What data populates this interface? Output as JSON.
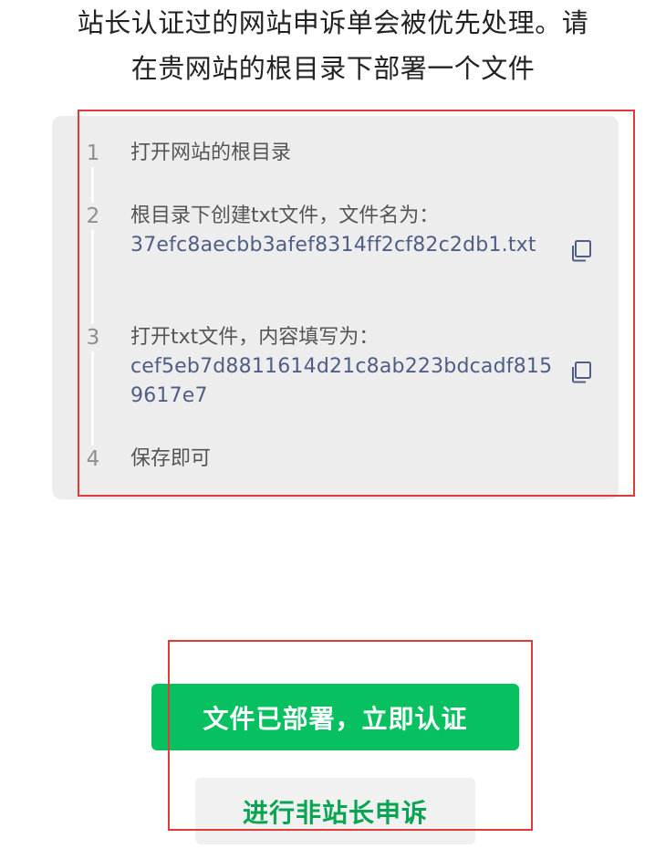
{
  "intro": {
    "line1": "站长认证过的网站申诉单会被优先处理。请",
    "line2": "在贵网站的根目录下部署一个文件"
  },
  "steps": [
    {
      "number": "1",
      "text": "打开网站的根目录"
    },
    {
      "number": "2",
      "text": "根目录下创建txt文件，文件名为：",
      "value": "37efc8aecbb3afef8314ff2cf82c2db1.txt"
    },
    {
      "number": "3",
      "text": "打开txt文件，内容填写为：",
      "value": "cef5eb7d8811614d21c8ab223bdcadf8159617e7"
    },
    {
      "number": "4",
      "text": "保存即可"
    }
  ],
  "buttons": {
    "primary_label": "文件已部署，立即认证",
    "secondary_label": "进行非站长申诉"
  },
  "icons": {
    "copy": "copy-icon"
  },
  "colors": {
    "primary": "#07c160",
    "secondary_text": "#07a552",
    "value_text": "#4e5e85",
    "highlight_box": "#e03b3b"
  }
}
